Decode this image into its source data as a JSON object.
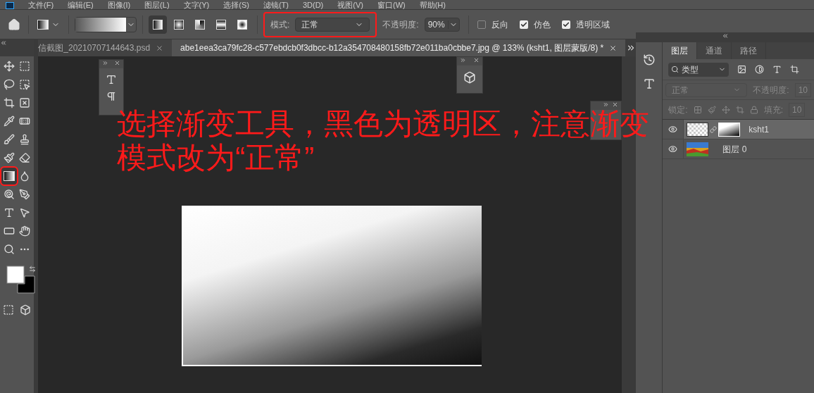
{
  "menu": [
    "文件(F)",
    "编辑(E)",
    "图像(I)",
    "图层(L)",
    "文字(Y)",
    "选择(S)",
    "滤镜(T)",
    "3D(D)",
    "视图(V)",
    "窗口(W)",
    "帮助(H)"
  ],
  "options_bar": {
    "gradient_types": [
      {
        "selected": true
      },
      {
        "selected": false
      },
      {
        "selected": false
      },
      {
        "selected": false
      },
      {
        "selected": false
      }
    ],
    "mode": {
      "label": "模式:",
      "value": "正常",
      "highlighted": true
    },
    "opacity": {
      "label": "不透明度:",
      "value": "90%"
    },
    "checkboxes": [
      {
        "label": "反向",
        "checked": false
      },
      {
        "label": "仿色",
        "checked": true
      },
      {
        "label": "透明区域",
        "checked": true
      }
    ]
  },
  "document_tabs": [
    {
      "title": "信截图_20210707144643.psd",
      "selected": false
    },
    {
      "title": "abe1eea3ca79fc28-c577ebdcb0f3dbcc-b12a354708480158fb72e011ba0cbbe7.jpg @ 133% (ksht1, 图层蒙版/8) *",
      "selected": true
    }
  ],
  "tools": [
    {
      "selected": false
    },
    {
      "selected": false
    },
    {
      "selected": false
    },
    {
      "selected": false
    },
    {
      "selected": false
    },
    {
      "selected": false
    },
    {
      "selected": false
    },
    {
      "selected": false
    },
    {
      "selected": false
    },
    {
      "selected": false
    },
    {
      "selected": false
    },
    {
      "selected": false
    },
    {
      "selected": true,
      "highlighted": true
    },
    {
      "selected": false
    },
    {
      "selected": false
    },
    {
      "selected": false
    },
    {
      "selected": false
    },
    {
      "selected": false
    },
    {
      "selected": false
    },
    {
      "selected": false
    },
    {
      "selected": false
    },
    {
      "selected": false
    }
  ],
  "annotation": {
    "text": "选择渐变工具，黑色为透明区，注意渐变模式改为“正常”"
  },
  "layers_panel": {
    "tabs": [
      {
        "label": "图层",
        "selected": true
      },
      {
        "label": "通道",
        "selected": false
      },
      {
        "label": "路径",
        "selected": false
      }
    ],
    "filter": "类型",
    "blend_mode": "正常",
    "opacity_label": "不透明度:",
    "opacity_value": "10",
    "lock_label": "锁定:",
    "fill_label": "填充:",
    "fill_value": "10",
    "layers": [
      {
        "name": "ksht1",
        "selected": true,
        "has_mask": true
      },
      {
        "name": "图层 0",
        "selected": false,
        "has_mask": false
      }
    ]
  }
}
